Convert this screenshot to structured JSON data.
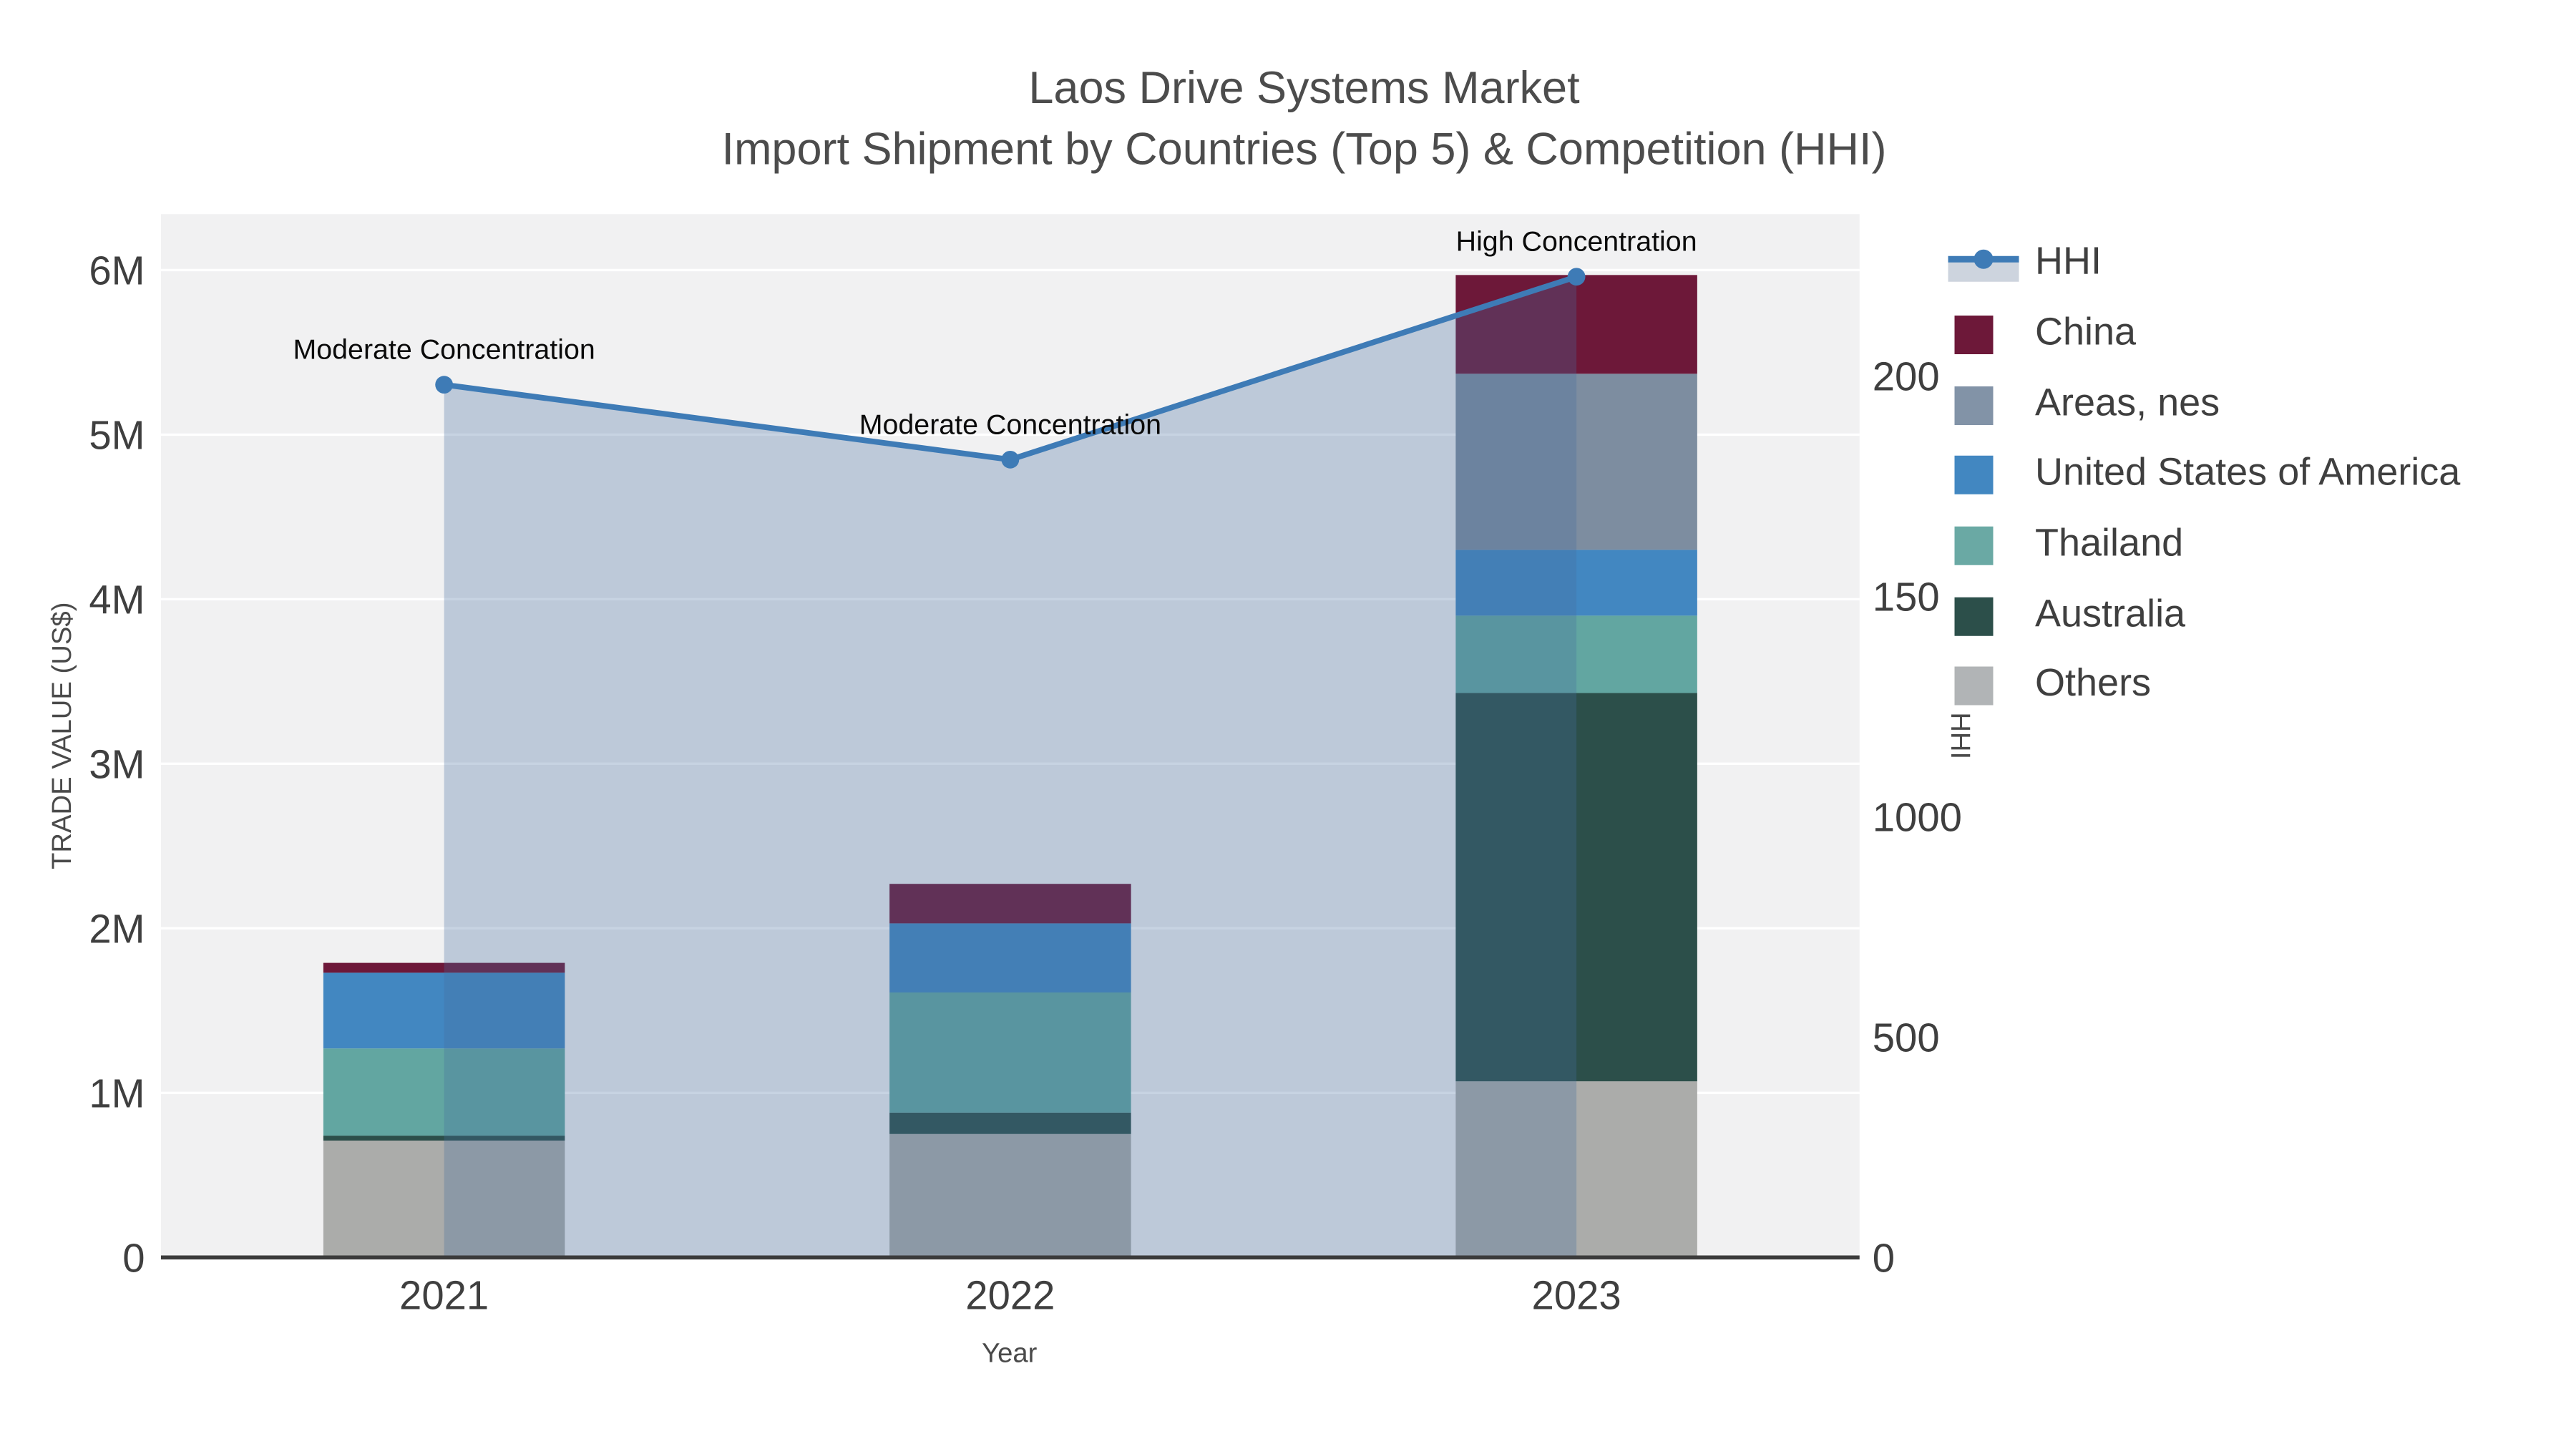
{
  "title": {
    "line1": "Laos Drive Systems Market",
    "line2": "Import Shipment by Countries (Top 5) & Competition (HHI)"
  },
  "axes": {
    "x": {
      "title": "Year",
      "categories": [
        "2021",
        "2022",
        "2023"
      ]
    },
    "y_left": {
      "title": "TRADE VALUE (US$)",
      "tick_labels": [
        "0",
        "1M",
        "2M",
        "3M",
        "4M",
        "5M",
        "6M"
      ],
      "tick_values": [
        0,
        1000000,
        2000000,
        3000000,
        4000000,
        5000000,
        6000000
      ],
      "range": [
        0,
        6340000
      ]
    },
    "y_right": {
      "title": "HHI",
      "tick_labels": [
        "0",
        "500",
        "1000",
        "150",
        "200"
      ],
      "tick_values": [
        0,
        500,
        1000,
        1500,
        2000
      ],
      "range": [
        0,
        2367
      ]
    }
  },
  "chart_data": {
    "type": "bar+line",
    "categories": [
      "2021",
      "2022",
      "2023"
    ],
    "stack_order_note": "series listed bottom-to-top",
    "series": [
      {
        "name": "Others",
        "color": "#abacaa",
        "values": [
          710000,
          750000,
          1070000
        ]
      },
      {
        "name": "Australia",
        "color": "#2c4f4a",
        "values": [
          30000,
          130000,
          2360000
        ]
      },
      {
        "name": "Thailand",
        "color": "#62a6a1",
        "values": [
          530000,
          730000,
          470000
        ]
      },
      {
        "name": "United States of America",
        "color": "#4287c1",
        "values": [
          460000,
          420000,
          400000
        ]
      },
      {
        "name": "Areas, nes",
        "color": "#7d8da0",
        "values": [
          0,
          0,
          1070000
        ]
      },
      {
        "name": "China",
        "color": "#6d1839",
        "values": [
          60000,
          240000,
          600000
        ]
      }
    ],
    "line": {
      "name": "HHI",
      "color": "#3e7bb6",
      "fill_color": "rgba(70,110,160,0.30)",
      "legend_band_color": "#cdd4de",
      "values": [
        1980,
        1810,
        2225
      ],
      "annotations": [
        "Moderate Concentration",
        "Moderate Concentration",
        "High Concentration"
      ]
    }
  },
  "legend": {
    "items": [
      {
        "label": "HHI",
        "type": "line",
        "color": "#3e7bb6"
      },
      {
        "label": "China",
        "type": "swatch",
        "color": "#6d1839"
      },
      {
        "label": "Areas, nes",
        "type": "swatch",
        "color": "#8293a7"
      },
      {
        "label": "United States of America",
        "type": "swatch",
        "color": "#4287c1"
      },
      {
        "label": "Thailand",
        "type": "swatch",
        "color": "#6aa9a4"
      },
      {
        "label": "Australia",
        "type": "swatch",
        "color": "#2c4f4a"
      },
      {
        "label": "Others",
        "type": "swatch",
        "color": "#b1b4b6"
      }
    ]
  },
  "colors": {
    "plot_background": "#f1f1f2",
    "gridline": "#ffffff",
    "axis_line": "#3b3b3b",
    "annotation_text": "#0a0a0a",
    "title_text": "#4c4c4c"
  }
}
